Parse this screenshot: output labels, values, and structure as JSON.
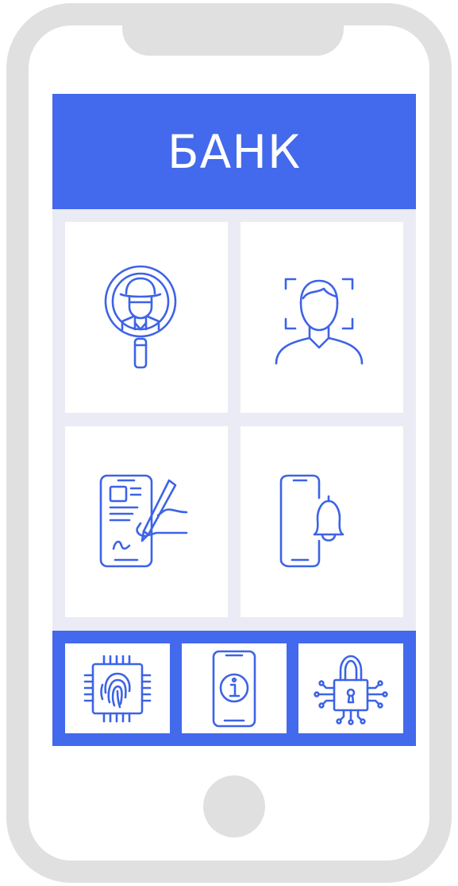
{
  "app": {
    "title": "БАНК"
  },
  "colors": {
    "accent": "#4369ec",
    "icon_stroke": "#3d63e6",
    "screen_bg": "#ebebf5",
    "phone_frame": "#e0e0e0"
  },
  "tiles": [
    {
      "icon": "fraud-detective-magnifier-icon"
    },
    {
      "icon": "face-id-scan-icon"
    },
    {
      "icon": "digital-signature-icon"
    },
    {
      "icon": "phone-notification-bell-icon"
    }
  ],
  "bottom_bar": [
    {
      "icon": "fingerprint-chip-icon"
    },
    {
      "icon": "phone-info-icon"
    },
    {
      "icon": "cyber-lock-icon"
    }
  ]
}
